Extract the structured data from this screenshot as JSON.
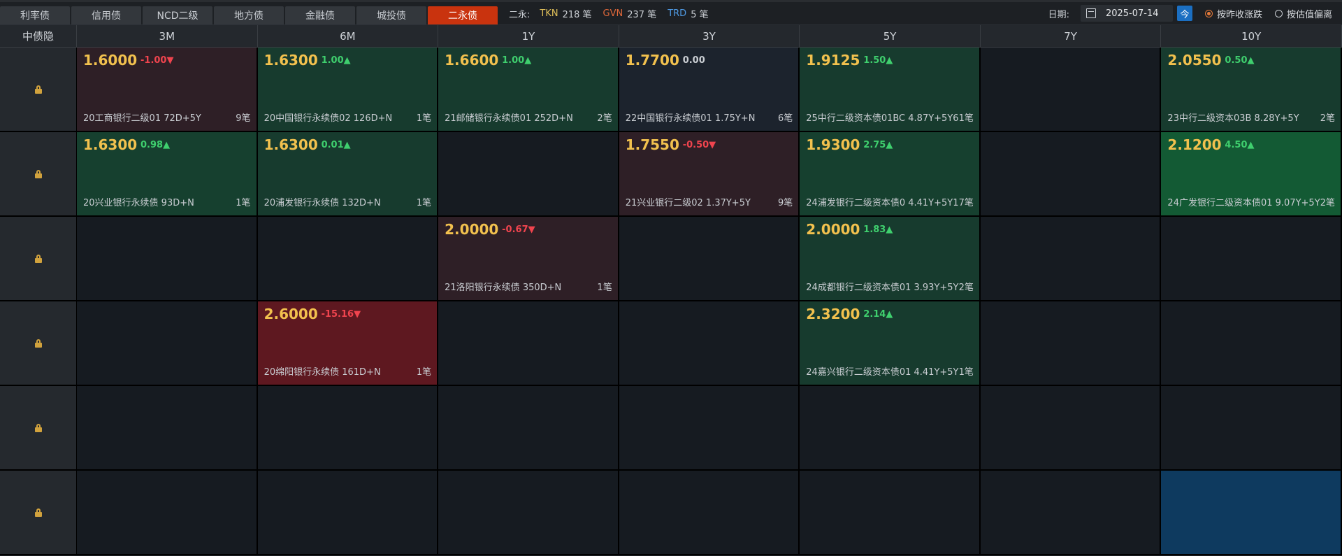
{
  "tabs": [
    {
      "label": "利率债",
      "active": false
    },
    {
      "label": "信用债",
      "active": false
    },
    {
      "label": "NCD二级",
      "active": false
    },
    {
      "label": "地方债",
      "active": false
    },
    {
      "label": "金融债",
      "active": false
    },
    {
      "label": "城投债",
      "active": false
    },
    {
      "label": "二永债",
      "active": true
    }
  ],
  "summary": {
    "label": "二永:",
    "tkn_label": "TKN",
    "tkn_value": "218 笔",
    "gvn_label": "GVN",
    "gvn_value": "237 笔",
    "trd_label": "TRD",
    "trd_value": "5 笔"
  },
  "controls": {
    "date_label": "日期:",
    "date_value": "2025-07-14",
    "today_button": "今",
    "radio1": "按昨收涨跌",
    "radio2": "按估值偏离"
  },
  "grid": {
    "corner": "中债隐",
    "columns": [
      "3M",
      "6M",
      "1Y",
      "3Y",
      "5Y",
      "7Y",
      "10Y"
    ],
    "rows": [
      [
        {
          "price": "1.6000",
          "chg": "-1.00▼",
          "dir": "down",
          "name": "20工商银行二级01 72D+5Y",
          "count": "9笔",
          "bg": "bg-darkred"
        },
        {
          "price": "1.6300",
          "chg": "1.00▲",
          "dir": "up",
          "name": "20中国银行永续债02 126D+N",
          "count": "1笔",
          "bg": "bg-green"
        },
        {
          "price": "1.6600",
          "chg": "1.00▲",
          "dir": "up",
          "name": "21邮储银行永续债01 252D+N",
          "count": "2笔",
          "bg": "bg-green"
        },
        {
          "price": "1.7700",
          "chg": "0.00",
          "dir": "flat",
          "name": "22中国银行永续债01 1.75Y+N",
          "count": "6笔",
          "bg": "bg-slate"
        },
        {
          "price": "1.9125",
          "chg": "1.50▲",
          "dir": "up",
          "name": "25中行二级资本债01BC 4.87Y+5Y",
          "count": "61笔",
          "bg": "bg-green"
        },
        null,
        {
          "price": "2.0550",
          "chg": "0.50▲",
          "dir": "up",
          "name": "23中行二级资本03B 8.28Y+5Y",
          "count": "2笔",
          "bg": "bg-green"
        }
      ],
      [
        {
          "price": "1.6300",
          "chg": "0.98▲",
          "dir": "up",
          "name": "20兴业银行永续债 93D+N",
          "count": "1笔",
          "bg": "bg-green2"
        },
        {
          "price": "1.6300",
          "chg": "0.01▲",
          "dir": "up",
          "name": "20浦发银行永续债 132D+N",
          "count": "1笔",
          "bg": "bg-green"
        },
        null,
        {
          "price": "1.7550",
          "chg": "-0.50▼",
          "dir": "down",
          "name": "21兴业银行二级02 1.37Y+5Y",
          "count": "9笔",
          "bg": "bg-darkred"
        },
        {
          "price": "1.9300",
          "chg": "2.75▲",
          "dir": "up",
          "name": "24浦发银行二级资本债0 4.41Y+5Y",
          "count": "17笔",
          "bg": "bg-green2"
        },
        null,
        {
          "price": "2.1200",
          "chg": "4.50▲",
          "dir": "up",
          "name": "24广发银行二级资本债01 9.07Y+5Y",
          "count": "2笔",
          "bg": "bg-green3"
        }
      ],
      [
        null,
        null,
        {
          "price": "2.0000",
          "chg": "-0.67▼",
          "dir": "down",
          "name": "21洛阳银行永续债 350D+N",
          "count": "1笔",
          "bg": "bg-darkred"
        },
        null,
        {
          "price": "2.0000",
          "chg": "1.83▲",
          "dir": "up",
          "name": "24成都银行二级资本债01 3.93Y+5Y",
          "count": "2笔",
          "bg": "bg-green"
        },
        null,
        null
      ],
      [
        null,
        {
          "price": "2.6000",
          "chg": "-15.16▼",
          "dir": "down",
          "name": "20绵阳银行永续债 161D+N",
          "count": "1笔",
          "bg": "bg-red"
        },
        null,
        null,
        {
          "price": "2.3200",
          "chg": "2.14▲",
          "dir": "up",
          "name": "24嘉兴银行二级资本债01 4.41Y+5Y",
          "count": "1笔",
          "bg": "bg-green"
        },
        null,
        null
      ],
      [
        null,
        null,
        null,
        null,
        null,
        null,
        null
      ],
      [
        null,
        null,
        null,
        null,
        null,
        null,
        {
          "empty": true,
          "bg": "bg-blue"
        }
      ]
    ]
  },
  "colors": {
    "accent_tab": "#c9330e",
    "price": "#f2c14e",
    "up": "#3fcf6e",
    "down": "#f0444e",
    "today_btn": "#1b6fc2"
  }
}
